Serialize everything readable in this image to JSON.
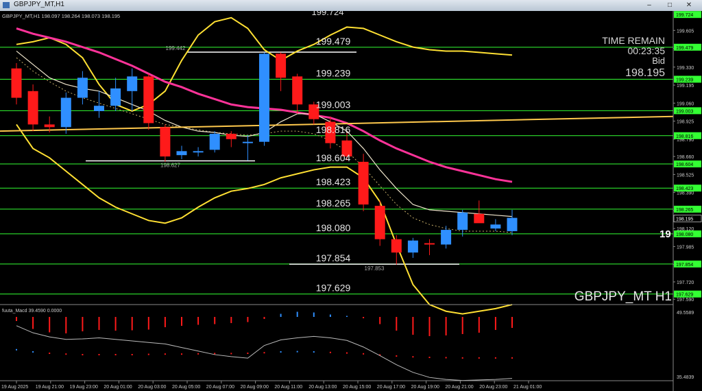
{
  "window": {
    "title": "GBPJPY_MT,H1",
    "min_glyph": "–",
    "max_glyph": "□",
    "close_glyph": "✕"
  },
  "header": {
    "ohlc_text": "GBPJPY_MT,H1  198.097 198.264 198.073 198.195"
  },
  "top_cut_label": "199.724",
  "info": {
    "time_label": "TIME REMAIN",
    "time_value": "00:23:35",
    "bid_label": "Bid",
    "bid_value": "198.195"
  },
  "symbol_label": "GBPJPY_MT H1",
  "big_partial": "19",
  "colors": {
    "bull": "#2f8fff",
    "bear": "#ff1a1a",
    "level": "#33ff33",
    "ma_slow": "#ff3399",
    "band": "#ffe033",
    "trend": "#ffc94d",
    "ma_fast": "#f0e6cc"
  },
  "chart_data": {
    "type": "candlestick",
    "time_labels": [
      "19 Aug 2025",
      "19 Aug 21:00",
      "19 Aug 23:00",
      "20 Aug 01:00",
      "20 Aug 03:00",
      "20 Aug 05:00",
      "20 Aug 07:00",
      "20 Aug 09:00",
      "20 Aug 11:00",
      "20 Aug 13:00",
      "20 Aug 15:00",
      "20 Aug 17:00",
      "20 Aug 19:00",
      "20 Aug 21:00",
      "20 Aug 23:00",
      "21 Aug 01:00"
    ],
    "price_range": [
      197.55,
      199.73
    ],
    "price_ticks": [
      199.605,
      199.47,
      199.33,
      199.195,
      199.06,
      198.925,
      198.79,
      198.66,
      198.525,
      198.39,
      198.255,
      198.12,
      197.985,
      197.85,
      197.72,
      197.59
    ],
    "price_tags": [
      "199.724",
      "199.479",
      "199.239",
      "199.003",
      "198.816",
      "198.604",
      "198.423",
      "198.265",
      "198.195",
      "198.080",
      "197.854",
      "197.629"
    ],
    "levels": [
      199.479,
      199.239,
      199.003,
      198.816,
      198.604,
      198.423,
      198.265,
      198.08,
      197.854,
      197.629
    ],
    "level_labels": [
      "199.479",
      "199.239",
      "199.003",
      "198.816",
      "198.604",
      "198.423",
      "198.265",
      "198.080",
      "197.854",
      "197.629"
    ],
    "annotations": [
      {
        "text": "199.442",
        "price": 199.442
      },
      {
        "text": "198.627",
        "price": 198.627
      },
      {
        "text": "197.853",
        "price": 197.853
      }
    ],
    "candles": [
      {
        "o": 199.32,
        "h": 199.36,
        "l": 199.05,
        "c": 199.1
      },
      {
        "o": 199.15,
        "h": 199.2,
        "l": 198.85,
        "c": 198.9
      },
      {
        "o": 198.9,
        "h": 198.96,
        "l": 198.84,
        "c": 198.88
      },
      {
        "o": 198.88,
        "h": 199.14,
        "l": 198.83,
        "c": 199.1
      },
      {
        "o": 199.1,
        "h": 199.3,
        "l": 199.05,
        "c": 199.25
      },
      {
        "o": 199.0,
        "h": 199.15,
        "l": 198.95,
        "c": 199.04
      },
      {
        "o": 199.04,
        "h": 199.25,
        "l": 199.0,
        "c": 199.17
      },
      {
        "o": 199.15,
        "h": 199.32,
        "l": 199.0,
        "c": 199.26
      },
      {
        "o": 199.26,
        "h": 199.28,
        "l": 198.86,
        "c": 198.91
      },
      {
        "o": 198.88,
        "h": 198.9,
        "l": 198.62,
        "c": 198.66
      },
      {
        "o": 198.67,
        "h": 198.74,
        "l": 198.64,
        "c": 198.7
      },
      {
        "o": 198.69,
        "h": 198.73,
        "l": 198.66,
        "c": 198.7
      },
      {
        "o": 198.71,
        "h": 198.85,
        "l": 198.69,
        "c": 198.83
      },
      {
        "o": 198.83,
        "h": 198.85,
        "l": 198.73,
        "c": 198.79
      },
      {
        "o": 198.76,
        "h": 198.82,
        "l": 198.63,
        "c": 198.77
      },
      {
        "o": 198.77,
        "h": 199.44,
        "l": 198.74,
        "c": 199.43
      },
      {
        "o": 199.43,
        "h": 199.44,
        "l": 199.15,
        "c": 199.25
      },
      {
        "o": 199.26,
        "h": 199.28,
        "l": 198.98,
        "c": 199.05
      },
      {
        "o": 199.05,
        "h": 199.07,
        "l": 198.9,
        "c": 198.94
      },
      {
        "o": 198.92,
        "h": 198.96,
        "l": 198.72,
        "c": 198.76
      },
      {
        "o": 198.78,
        "h": 198.84,
        "l": 198.63,
        "c": 198.66
      },
      {
        "o": 198.62,
        "h": 198.68,
        "l": 198.25,
        "c": 198.3
      },
      {
        "o": 198.29,
        "h": 198.33,
        "l": 197.99,
        "c": 198.04
      },
      {
        "o": 198.04,
        "h": 198.07,
        "l": 197.85,
        "c": 197.94
      },
      {
        "o": 197.94,
        "h": 198.05,
        "l": 197.9,
        "c": 198.03
      },
      {
        "o": 198.01,
        "h": 198.04,
        "l": 197.92,
        "c": 198.0
      },
      {
        "o": 198.0,
        "h": 198.14,
        "l": 197.97,
        "c": 198.11
      },
      {
        "o": 198.11,
        "h": 198.26,
        "l": 198.06,
        "c": 198.24
      },
      {
        "o": 198.23,
        "h": 198.33,
        "l": 198.17,
        "c": 198.16
      },
      {
        "o": 198.12,
        "h": 198.19,
        "l": 198.1,
        "c": 198.15
      },
      {
        "o": 198.1,
        "h": 198.26,
        "l": 198.07,
        "c": 198.2
      }
    ],
    "ma_fast": [
      199.45,
      199.35,
      199.25,
      199.2,
      199.17,
      199.15,
      199.1,
      199.05,
      199.0,
      198.93,
      198.88,
      198.85,
      198.84,
      198.82,
      198.81,
      198.84,
      198.92,
      198.98,
      198.98,
      198.92,
      198.85,
      198.72,
      198.56,
      198.42,
      198.3,
      198.26,
      198.25,
      198.24,
      198.23,
      198.22,
      198.21
    ],
    "ma_slow": [
      199.62,
      199.58,
      199.55,
      199.52,
      199.48,
      199.44,
      199.39,
      199.34,
      199.28,
      199.22,
      199.18,
      199.13,
      199.09,
      199.05,
      199.03,
      199.02,
      199.01,
      198.99,
      198.97,
      198.95,
      198.91,
      198.85,
      198.78,
      198.72,
      198.67,
      198.62,
      198.58,
      198.55,
      198.52,
      198.49,
      198.47
    ],
    "trend_line": {
      "from": 198.85,
      "to": 198.96
    },
    "band_upper": [
      199.5,
      199.52,
      199.55,
      199.5,
      199.4,
      199.2,
      199.05,
      199.0,
      199.05,
      199.15,
      199.38,
      199.57,
      199.67,
      199.7,
      199.62,
      199.46,
      199.38,
      199.45,
      199.5,
      199.57,
      199.63,
      199.62,
      199.57,
      199.52,
      199.48,
      199.46,
      199.45,
      199.45,
      199.44,
      199.43,
      199.42
    ],
    "band_lower": [
      198.9,
      198.72,
      198.65,
      198.55,
      198.45,
      198.35,
      198.28,
      198.23,
      198.18,
      198.16,
      198.2,
      198.28,
      198.35,
      198.4,
      198.42,
      198.45,
      198.5,
      198.53,
      198.56,
      198.58,
      198.58,
      198.5,
      198.32,
      198.0,
      197.7,
      197.55,
      197.5,
      197.48,
      197.5,
      197.52,
      197.55
    ],
    "dotted_mid": [
      199.4,
      199.3,
      199.22,
      199.15,
      199.1,
      199.06,
      199.02,
      198.98,
      198.94,
      198.9,
      198.88,
      198.86,
      198.84,
      198.83,
      198.82,
      198.83,
      198.85,
      198.85,
      198.83,
      198.78,
      198.7,
      198.58,
      198.44,
      198.3,
      198.2,
      198.15,
      198.12,
      198.1,
      198.1,
      198.1,
      198.09
    ],
    "macd": {
      "label": "fuuta_Macd 39.4590  0.0000",
      "range": [
        35.4839,
        49.5589
      ],
      "tick_labels": [
        "49.5589",
        "35.4839"
      ],
      "hist": [
        -1.2,
        -3.5,
        -4.5,
        -4.8,
        -4.2,
        -3.8,
        -4.0,
        -3.9,
        -3.7,
        -3.0,
        -2.6,
        -2.3,
        -2.1,
        -1.8,
        -1.5,
        -0.6,
        0.9,
        1.5,
        1.3,
        0.7,
        0.3,
        -0.4,
        -2.1,
        -4.0,
        -5.2,
        -5.6,
        -5.4,
        -5.0,
        -4.6,
        -3.8,
        -3.2
      ],
      "signal": [
        0.3,
        -0.5,
        -1.0,
        -1.3,
        -1.5,
        -1.5,
        -1.5,
        -1.5,
        -1.4,
        -1.3,
        -1.3,
        -1.2,
        -1.1,
        -1.1,
        -1.0,
        -0.8,
        -0.5,
        -0.4,
        -0.5,
        -0.7,
        -0.9,
        -1.2,
        -1.6,
        -2.0,
        -2.3,
        -2.5,
        -2.6,
        -2.7,
        -2.7,
        -2.7,
        -2.7
      ],
      "line": [
        46.2,
        44.8,
        44.0,
        43.5,
        43.6,
        43.8,
        43.5,
        43.2,
        42.9,
        42.6,
        41.9,
        41.2,
        40.5,
        40.1,
        39.8,
        42.3,
        43.4,
        43.8,
        44.1,
        43.8,
        43.3,
        42.0,
        40.3,
        38.5,
        37.0,
        36.0,
        35.6,
        35.4,
        35.5,
        35.6,
        35.8
      ]
    }
  }
}
